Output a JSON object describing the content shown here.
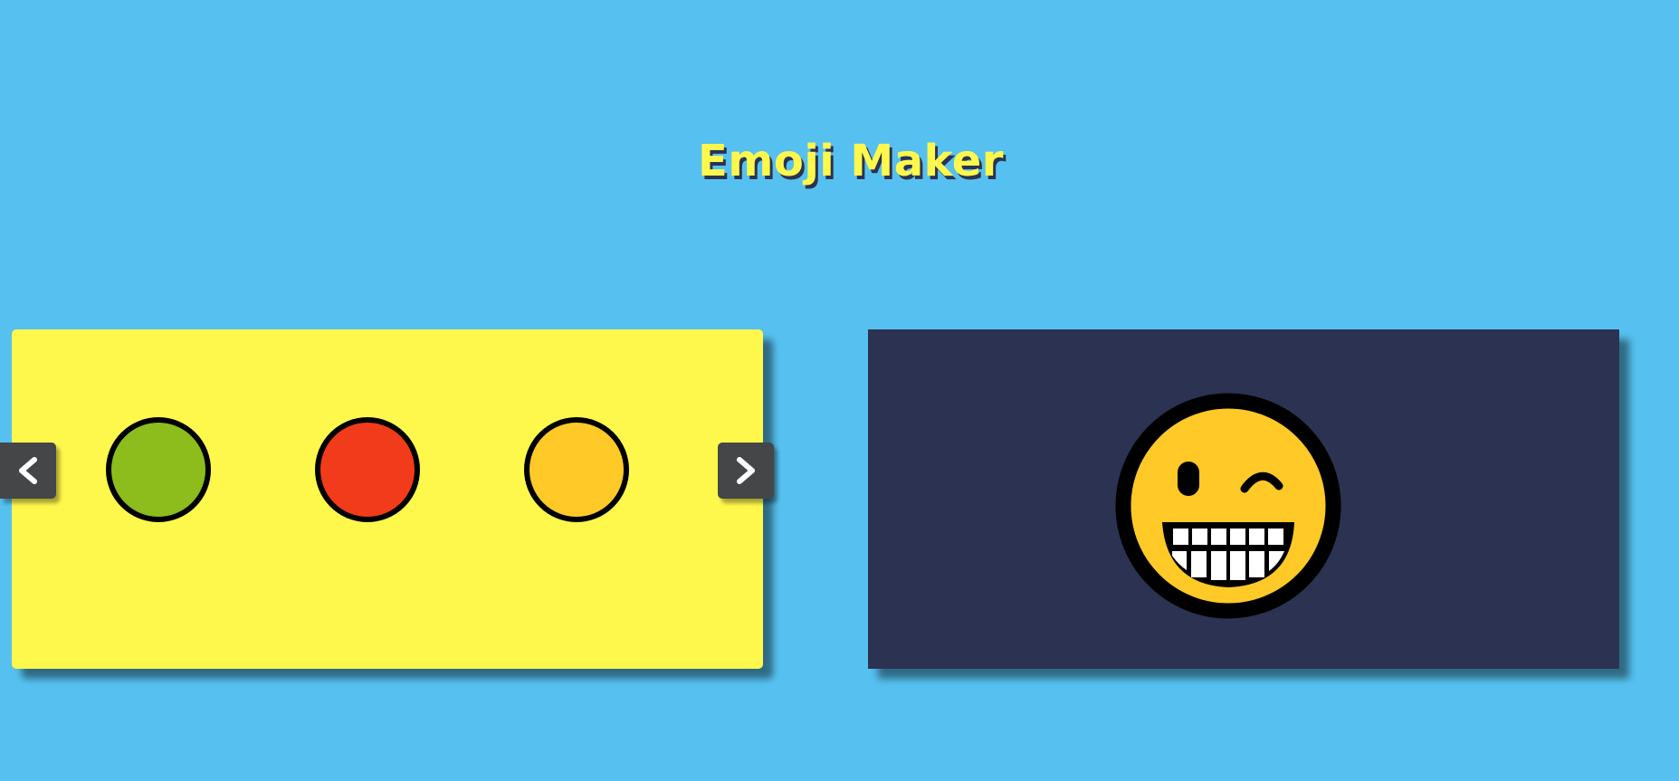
{
  "app": {
    "title": "Emoji Maker"
  },
  "colors": {
    "background": "#56c1f0",
    "title": "#fff84c",
    "title_shadow": "#2c3251",
    "picker_panel": "#fff84c",
    "preview_panel": "#2c3251",
    "arrow_button": "#444648"
  },
  "color_picker": {
    "swatches": [
      {
        "name": "green",
        "color": "#8cbd1c"
      },
      {
        "name": "red",
        "color": "#f23b1a"
      },
      {
        "name": "yellow",
        "color": "#ffc928"
      }
    ],
    "prev_icon": "chevron-left-icon",
    "next_icon": "chevron-right-icon"
  },
  "preview": {
    "face_color": "#ffc928",
    "expression": "wink-grin"
  }
}
